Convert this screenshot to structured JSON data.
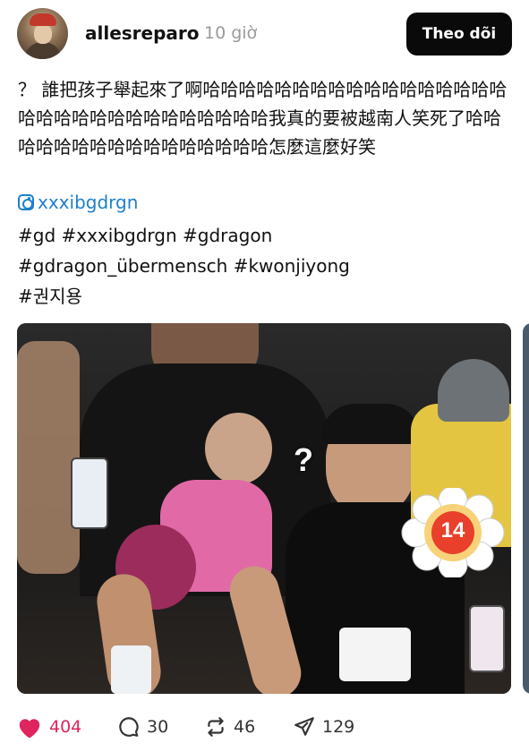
{
  "header": {
    "username": "allesreparo",
    "timestamp": "10 giờ",
    "follow_label": "Theo dõi"
  },
  "post": {
    "caption": "？ 誰把孩子舉起來了啊哈哈哈哈哈哈哈哈哈哈哈哈哈哈哈哈哈哈哈哈哈哈哈哈哈哈哈哈哈哈哈我真的要被越南人笑死了哈哈哈哈哈哈哈哈哈哈哈哈哈哈哈哈怎麼這麼好笑",
    "mention": "xxxibgdrgn",
    "hashtag_lines": [
      "#gd #xxxibgdrgn #gdragon",
      "#gdragon_übermensch #kwonjiyong",
      "#권지용"
    ],
    "image": {
      "overlay_question": "?",
      "overlay_badge": "14"
    }
  },
  "actions": {
    "likes": "404",
    "replies": "30",
    "reposts": "46",
    "shares": "129"
  },
  "icons": {
    "like": "heart-icon",
    "reply": "comment-bubble-icon",
    "repost": "repost-arrows-icon",
    "share": "send-paper-plane-icon",
    "mention": "instagram-icon"
  },
  "colors": {
    "like": "#e0245e",
    "link": "#1d80c9",
    "follow_bg": "#0a0a0a",
    "timestamp": "#9a9a9a"
  }
}
